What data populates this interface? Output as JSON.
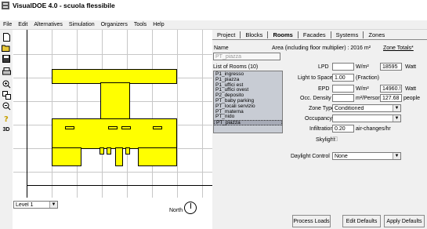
{
  "titlebar": {
    "title": "VisualDOE 4.0 - scuola flessibile"
  },
  "menu": [
    "File",
    "Edit",
    "Alternatives",
    "Simulation",
    "Organizers",
    "Tools",
    "Help"
  ],
  "toolbar": {
    "three_d_label": "3D"
  },
  "canvas": {
    "level_select": "Level 1",
    "north_label": "North"
  },
  "tabs": [
    "Project",
    "Blocks",
    "Rooms",
    "Facades",
    "Systems",
    "Zones"
  ],
  "active_tab": "Rooms",
  "room": {
    "name_label": "Name",
    "name_value": "PT_piazza",
    "area_label": "Area (including floor multiplier) : 2016 m²",
    "zone_totals": "Zone Totals*",
    "list_title": "List of Rooms (10)",
    "rooms": [
      "P1_ingresso",
      "P1_piazza",
      "P1_uffici est",
      "P1_uffici ovest",
      "P2_deposito",
      "PT_baby parking",
      "PT_locali servizio",
      "PT_materna",
      "PT_nido",
      "PT_piazza"
    ],
    "selected_room": "PT_piazza"
  },
  "props": {
    "lpd_label": "LPD",
    "lpd_value": "",
    "lpd_unit": "W/m²",
    "lpd_total": "18595",
    "lpd_total_unit": "Watt",
    "light_to_space_label": "Light to Space",
    "light_to_space_value": "1.00",
    "light_to_space_unit": "(Fraction)",
    "epd_label": "EPD",
    "epd_value": "",
    "epd_unit": "W/m²",
    "epd_total": "14960.!",
    "epd_total_unit": "Watt",
    "occ_density_label": "Occ. Density",
    "occ_density_value": "",
    "occ_density_unit": "m²/Person",
    "occ_total": "127.68",
    "occ_total_unit": "people",
    "zone_type_label": "Zone Type",
    "zone_type_value": "Conditioned",
    "occupancy_label": "Occupancy",
    "occupancy_value": "",
    "infiltration_label": "Infiltration",
    "infiltration_value": "0.20",
    "infiltration_unit": "air-changes/hr",
    "skylight_label": "Skylight",
    "skylight_check": "☑",
    "daylight_label": "Daylight Control",
    "daylight_value": "None"
  },
  "buttons": {
    "process_loads": "Process Loads",
    "edit_defaults": "Edit Defaults",
    "apply_defaults": "Apply Defaults"
  },
  "colors": {
    "room_fill": "#ffff00",
    "panel_bg": "#f0f0f0",
    "list_bg": "#c8ccd4",
    "selected_bg": "#a6aab6"
  }
}
